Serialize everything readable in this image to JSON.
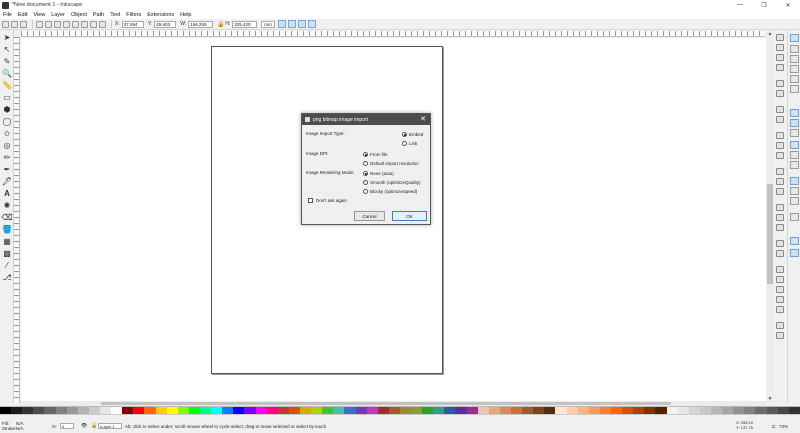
{
  "window": {
    "title": "*New document 1 - Inkscape",
    "minimize": "—",
    "maximize": "❐",
    "close": "✕"
  },
  "menu": [
    "File",
    "Edit",
    "View",
    "Layer",
    "Object",
    "Path",
    "Text",
    "Filters",
    "Extensions",
    "Help"
  ],
  "toolbar": {
    "x_label": "X:",
    "x_value": "37.594",
    "y_label": "Y:",
    "y_value": "29.603",
    "w_label": "W:",
    "w_value": "156.259",
    "h_label": "H:",
    "h_value": "325.420",
    "unit": "mm"
  },
  "dialog": {
    "title": "png bitmap image import",
    "close": "✕",
    "import_type_label": "Image Import Type:",
    "embed": "Embed",
    "link": "Link",
    "dpi_label": "Image DPI:",
    "from_file": "From file",
    "default_resolution": "Default import resolution",
    "rendering_label": "Image Rendering Mode:",
    "none_auto": "None (auto)",
    "smooth": "Smooth (optimizeQuality)",
    "blocky": "Blocky (optimizeSpeed)",
    "dont_ask": "Don't ask again",
    "cancel": "Cancel",
    "ok": "OK"
  },
  "status": {
    "fill_label": "Fill:",
    "fill_value": "N/A",
    "stroke_label": "Stroke:",
    "stroke_value": "N/A",
    "opacity_label": "O:",
    "opacity_value": "0",
    "layer": "•Layer 1",
    "message": "Alt: click to select under; scroll mouse wheel to cycle-select; drag to move selected or select by touch",
    "x_coord": "X: 255.10",
    "y_coord": "Y: 137.75",
    "zoom_label": "Z:",
    "zoom": "73%"
  },
  "palette": [
    "#000000",
    "#1a1a1a",
    "#333333",
    "#4d4d4d",
    "#666666",
    "#808080",
    "#999999",
    "#b3b3b3",
    "#cccccc",
    "#e6e6e6",
    "#ffffff",
    "#800000",
    "#ff0000",
    "#ff6600",
    "#ffcc00",
    "#ffff00",
    "#80ff00",
    "#00ff00",
    "#00ff80",
    "#00ffff",
    "#0080ff",
    "#0000ff",
    "#8000ff",
    "#ff00ff",
    "#ff0080",
    "#c83737",
    "#d45500",
    "#d4aa00",
    "#aad400",
    "#37c837",
    "#37c8ab",
    "#3771c8",
    "#7137c8",
    "#c837ab",
    "#a02c2c",
    "#a05a2c",
    "#a0892c",
    "#89a02c",
    "#2ca02c",
    "#2ca089",
    "#2c5aa0",
    "#5a2ca0",
    "#a02c89",
    "#e9c6af",
    "#deaa87",
    "#d38d5f",
    "#c87137",
    "#a05a2c",
    "#784421",
    "#502d16",
    "#ffe6d5",
    "#ffccaa",
    "#ffb380",
    "#ff9955",
    "#ff7f2a",
    "#ff6600",
    "#d45500",
    "#aa4400",
    "#803300",
    "#552200",
    "#f2f2f2",
    "#e6e6e6",
    "#d5d5d5",
    "#c8c8c8",
    "#b7b7b7",
    "#a6a6a6",
    "#939393",
    "#808080",
    "#6c6c6c",
    "#5a5a5a",
    "#484848",
    "#333333"
  ]
}
